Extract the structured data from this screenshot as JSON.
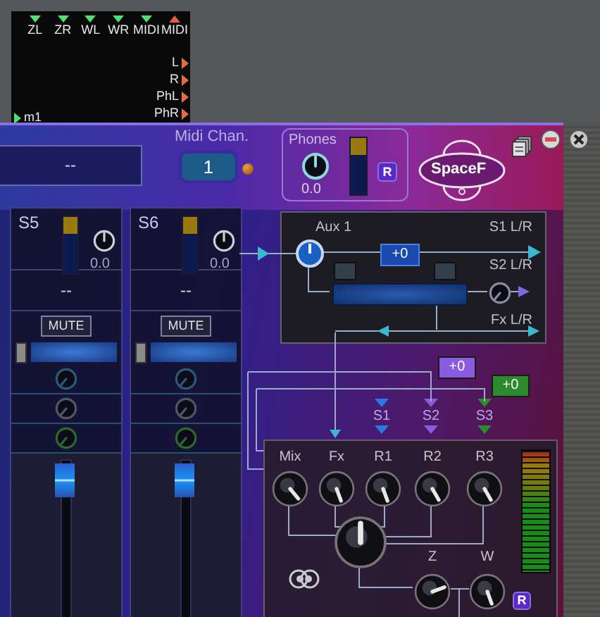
{
  "router": {
    "ports": [
      {
        "label": "ZL",
        "kind": "in"
      },
      {
        "label": "ZR",
        "kind": "in"
      },
      {
        "label": "WL",
        "kind": "in"
      },
      {
        "label": "WR",
        "kind": "in"
      },
      {
        "label": "MIDI",
        "kind": "in"
      },
      {
        "label": "MIDI",
        "kind": "out"
      }
    ],
    "outputs": [
      "L",
      "R",
      "PhL",
      "PhR"
    ],
    "inputs": [
      "m1"
    ]
  },
  "header": {
    "display": "--",
    "midi_label": "Midi Chan.",
    "midi_channel": "1",
    "phones": {
      "label": "Phones",
      "value": "0.0",
      "r_button": "R"
    },
    "logo": "SpaceF"
  },
  "channels": [
    {
      "name": "S5",
      "value": "0.0",
      "display": "--",
      "mute_label": "MUTE",
      "muted": false,
      "level": 0.98
    },
    {
      "name": "S6",
      "value": "0.0",
      "display": "--",
      "mute_label": "MUTE",
      "muted": false,
      "level": 0.98
    }
  ],
  "aux": {
    "title": "Aux 1",
    "amount": "+0",
    "outputs": [
      "S1 L/R",
      "S2 L/R",
      "Fx L/R"
    ]
  },
  "sends": [
    {
      "label": "S1",
      "color": "#2a7ae0"
    },
    {
      "label": "S2",
      "color": "#8a5ae0",
      "amount": "+0"
    },
    {
      "label": "S3",
      "color": "#2e8a2e",
      "amount": "+0"
    }
  ],
  "mixer": {
    "knobs": [
      "Mix",
      "Fx",
      "R1",
      "R2",
      "R3"
    ],
    "bottom_knobs": [
      "Z",
      "W"
    ],
    "r_button": "R"
  }
}
